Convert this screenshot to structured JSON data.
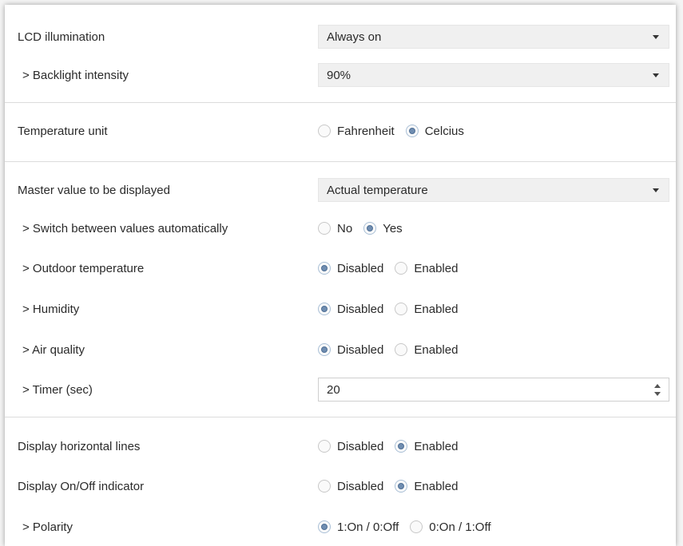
{
  "rows": {
    "lcd": {
      "label": "LCD illumination",
      "value": "Always on"
    },
    "backlight": {
      "label": "> Backlight intensity",
      "value": "90%"
    },
    "temp_unit": {
      "label": "Temperature unit",
      "options": [
        "Fahrenheit",
        "Celcius"
      ],
      "selected": "Celcius"
    },
    "master": {
      "label": "Master value to be displayed",
      "value": "Actual temperature"
    },
    "switch_auto": {
      "label": "> Switch between values automatically",
      "options": [
        "No",
        "Yes"
      ],
      "selected": "Yes"
    },
    "outdoor": {
      "label": "> Outdoor temperature",
      "options": [
        "Disabled",
        "Enabled"
      ],
      "selected": "Disabled"
    },
    "humidity": {
      "label": "> Humidity",
      "options": [
        "Disabled",
        "Enabled"
      ],
      "selected": "Disabled"
    },
    "air": {
      "label": "> Air quality",
      "options": [
        "Disabled",
        "Enabled"
      ],
      "selected": "Disabled"
    },
    "timer": {
      "label": "> Timer (sec)",
      "value": "20"
    },
    "hlines": {
      "label": "Display horizontal lines",
      "options": [
        "Disabled",
        "Enabled"
      ],
      "selected": "Enabled"
    },
    "onoff": {
      "label": "Display On/Off indicator",
      "options": [
        "Disabled",
        "Enabled"
      ],
      "selected": "Enabled"
    },
    "polarity": {
      "label": "> Polarity",
      "options": [
        "1:On / 0:Off",
        "0:On / 1:Off"
      ],
      "selected": "1:On / 0:Off"
    }
  }
}
